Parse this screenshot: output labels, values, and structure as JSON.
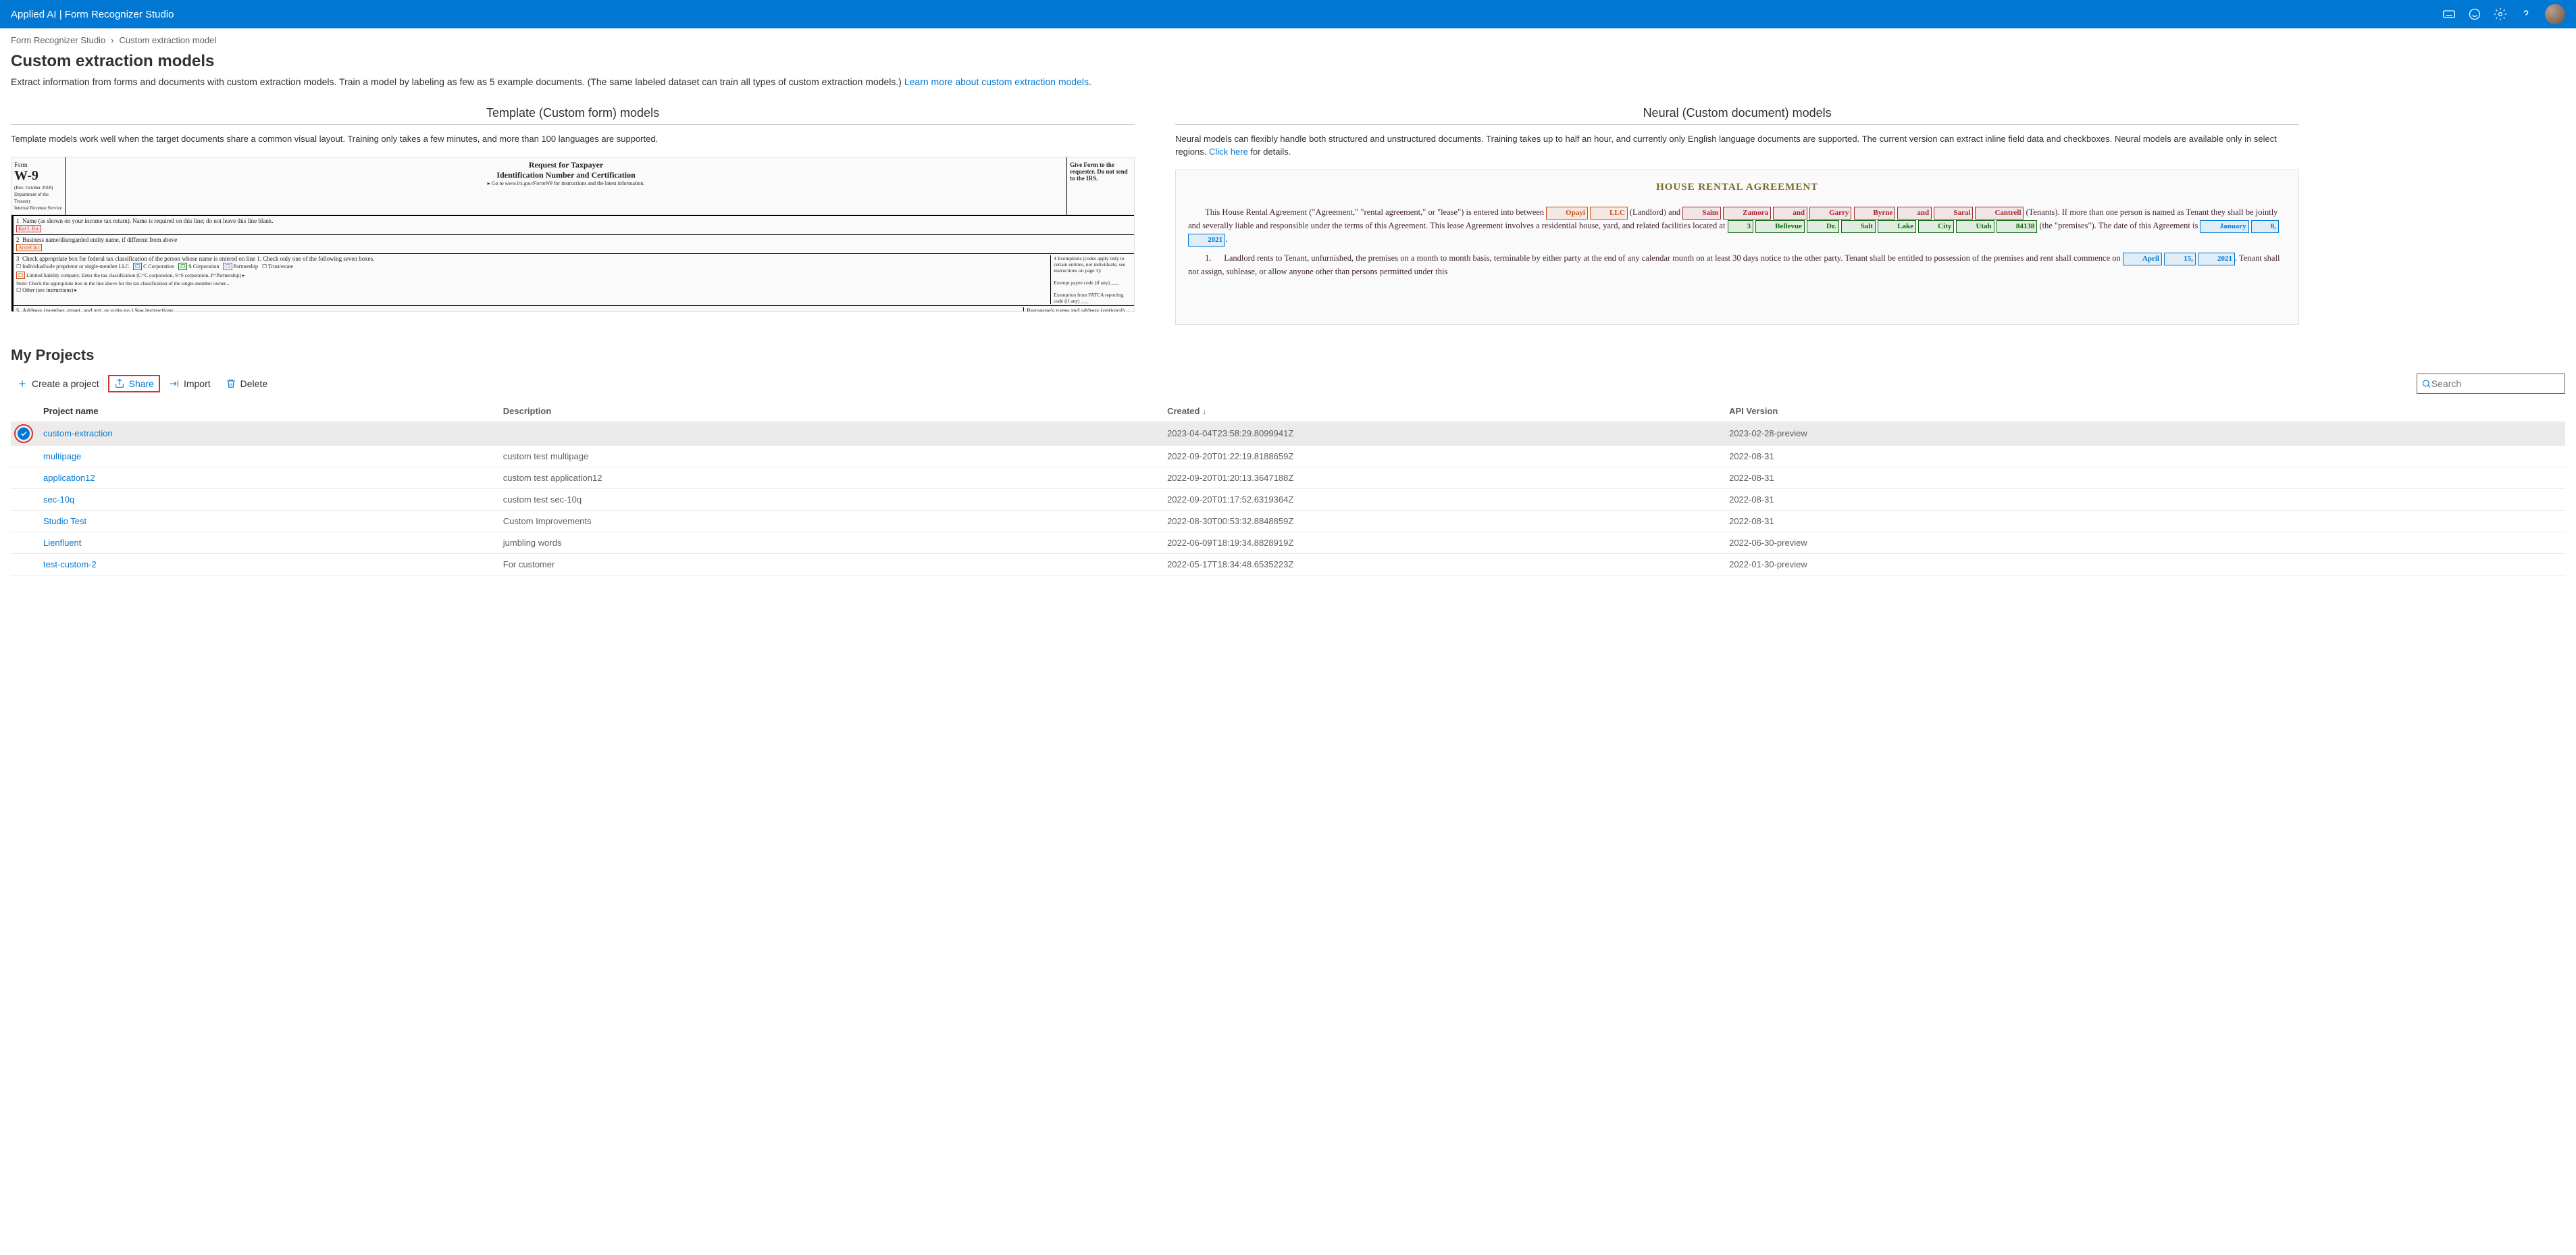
{
  "header": {
    "app_title": "Applied AI | Form Recognizer Studio"
  },
  "breadcrumb": {
    "root": "Form Recognizer Studio",
    "current": "Custom extraction model"
  },
  "page": {
    "title": "Custom extraction models",
    "description": "Extract information from forms and documents with custom extraction models. Train a model by labeling as few as 5 example documents. (The same labeled dataset can train all types of custom extraction models.) ",
    "learn_more": "Learn more about custom extraction models"
  },
  "template_model": {
    "heading": "Template (Custom form) models",
    "desc": "Template models work well when the target documents share a common visual layout. Training only takes a few minutes, and more than 100 languages are supported."
  },
  "neural_model": {
    "heading": "Neural (Custom document) models",
    "desc_pre": "Neural models can flexibly handle both structured and unstructured documents. Training takes up to half an hour, and currently only English language documents are supported. The current version can extract inline field data and checkboxes. Neural models are available only in select regions. ",
    "click_here": "Click here",
    "desc_post": " for details."
  },
  "neural_preview": {
    "title": "HOUSE RENTAL AGREEMENT"
  },
  "projects_heading": "My Projects",
  "toolbar": {
    "create": "Create a project",
    "share": "Share",
    "import": "Import",
    "delete": "Delete"
  },
  "search": {
    "placeholder": "Search"
  },
  "columns": {
    "name": "Project name",
    "desc": "Description",
    "created": "Created",
    "api": "API Version"
  },
  "projects": [
    {
      "name": "custom-extraction",
      "desc": "",
      "created": "2023-04-04T23:58:29.8099941Z",
      "api": "2023-02-28-preview",
      "selected": true
    },
    {
      "name": "multipage",
      "desc": "custom test multipage",
      "created": "2022-09-20T01:22:19.8188659Z",
      "api": "2022-08-31"
    },
    {
      "name": "application12",
      "desc": "custom test application12",
      "created": "2022-09-20T01:20:13.3647188Z",
      "api": "2022-08-31"
    },
    {
      "name": "sec-10q",
      "desc": "custom test sec-10q",
      "created": "2022-09-20T01:17:52.6319364Z",
      "api": "2022-08-31"
    },
    {
      "name": "Studio Test",
      "desc": "Custom Improvements",
      "created": "2022-08-30T00:53:32.8848859Z",
      "api": "2022-08-31"
    },
    {
      "name": "Lienfluent",
      "desc": "jumbling words",
      "created": "2022-06-09T18:19:34.8828919Z",
      "api": "2022-06-30-preview"
    },
    {
      "name": "test-custom-2",
      "desc": "For customer",
      "created": "2022-05-17T18:34:48.6535223Z",
      "api": "2022-01-30-preview"
    }
  ]
}
